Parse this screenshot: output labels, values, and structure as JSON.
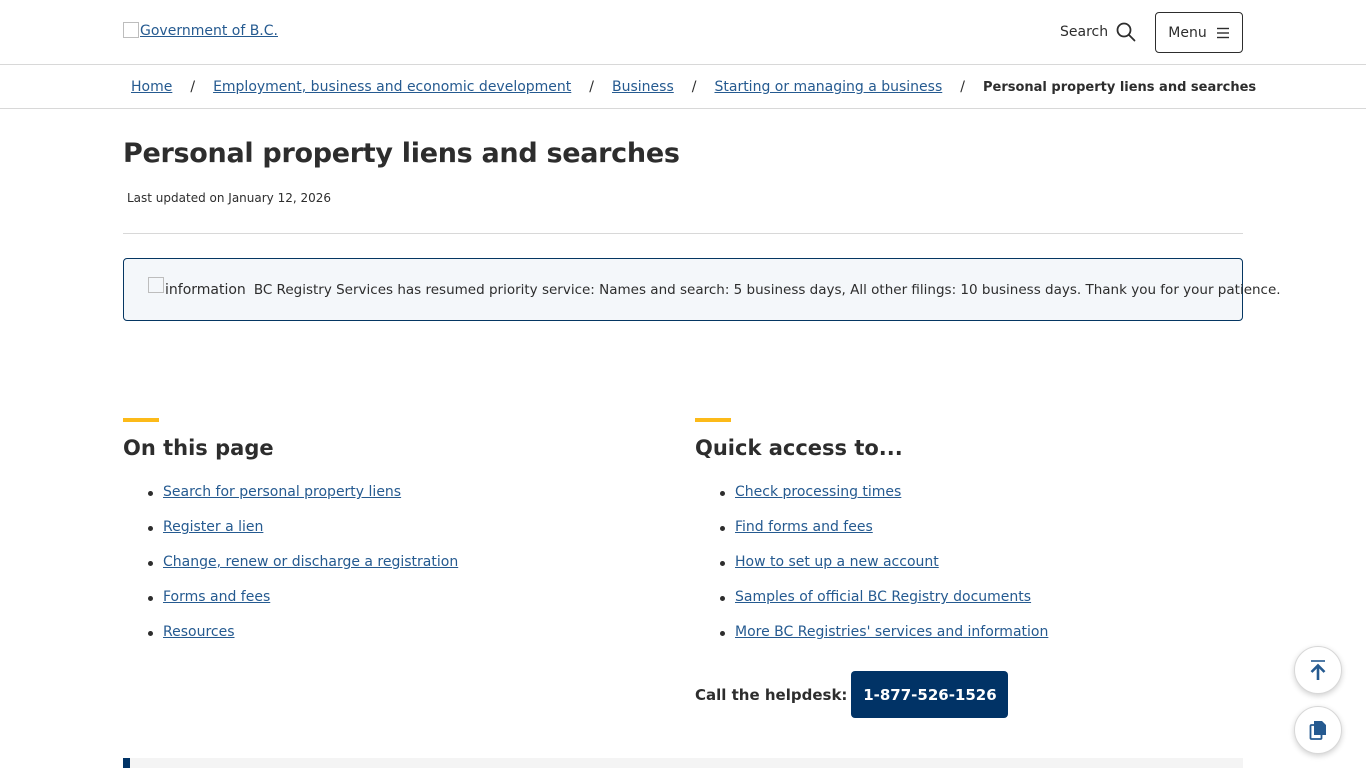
{
  "header": {
    "logo_alt": "Government of B.C.",
    "search_label": "Search",
    "menu_label": "Menu"
  },
  "breadcrumb": {
    "items": [
      "Home",
      "Employment, business and economic development",
      "Business",
      "Starting or managing a business"
    ],
    "current": "Personal property liens and searches",
    "separator": "/"
  },
  "page": {
    "title": "Personal property liens and searches",
    "updated": "Last updated on January 12, 2026"
  },
  "notice": {
    "icon_alt": "information",
    "text": "BC Registry Services has resumed priority service: Names and search: 5 business days, All other filings: 10 business days. Thank you for your patience."
  },
  "on_this_page": {
    "heading": "On this page",
    "links": [
      "Search for personal property liens",
      "Register a lien",
      "Change, renew or discharge a registration",
      "Forms and fees",
      "Resources"
    ]
  },
  "quick_access": {
    "heading": "Quick access to...",
    "links": [
      "Check processing times",
      "Find forms and fees",
      "How to set up a new account",
      "Samples of official BC Registry documents",
      "More BC Registries' services and information"
    ]
  },
  "helpdesk": {
    "label": "Call the helpdesk:",
    "phone": "1-877-526-1526"
  },
  "icons": {
    "search": "search-icon",
    "menu": "hamburger-icon",
    "back_to_top": "arrow-up-icon",
    "copy": "copy-icon"
  },
  "colors": {
    "link": "#255a90",
    "primary": "#013366",
    "accent": "#fcba19",
    "notice_border": "#053662",
    "notice_bg": "#f4f7fa"
  }
}
